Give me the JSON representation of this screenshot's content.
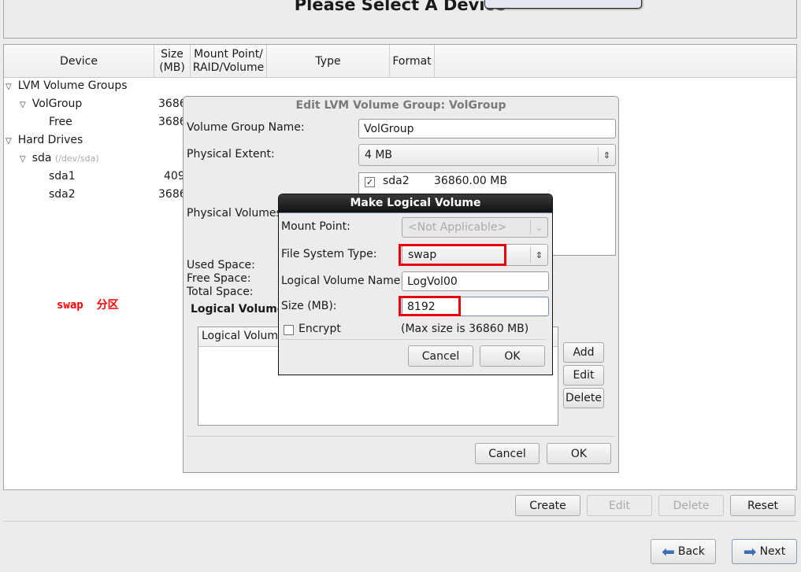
{
  "header": {
    "title": "Please Select A Device"
  },
  "table": {
    "columns": [
      "Device",
      "Size\n(MB)",
      "Mount Point/\nRAID/Volume",
      "Type",
      "Format"
    ],
    "col_device": "Device",
    "col_size_1": "Size",
    "col_size_2": "(MB)",
    "col_mount_1": "Mount Point/",
    "col_mount_2": "RAID/Volume",
    "col_type": "Type",
    "col_format": "Format",
    "rows": [
      {
        "label": "LVM Volume Groups",
        "size": ""
      },
      {
        "label": "VolGroup",
        "size": "3686"
      },
      {
        "label": "Free",
        "size": "3686"
      },
      {
        "label": "Hard Drives",
        "size": ""
      },
      {
        "label": "sda",
        "sub": "(/dev/sda)",
        "size": ""
      },
      {
        "label": "sda1",
        "size": "409"
      },
      {
        "label": "sda2",
        "size": "3686"
      }
    ]
  },
  "annotation": {
    "text": "swap  分区",
    "color": "#ff0000"
  },
  "lvm_dialog": {
    "title": "Edit LVM Volume Group: VolGroup",
    "vg_name_label": "Volume Group Name:",
    "vg_name_value": "VolGroup",
    "extent_label": "Physical Extent:",
    "extent_value": "4 MB",
    "pv_label": "Physical Volumes",
    "pv_items": [
      {
        "checked": true,
        "name": "sda2",
        "size": "36860.00 MB"
      }
    ],
    "used_label": "Used Space:",
    "free_label": "Free Space:",
    "total_label": "Total Space:",
    "lv_section": "Logical Volume",
    "lv_col": "Logical Volume",
    "add": "Add",
    "edit": "Edit",
    "delete": "Delete",
    "cancel": "Cancel",
    "ok": "OK"
  },
  "make_lv": {
    "title": "Make Logical Volume",
    "mount_label": "Mount Point:",
    "mount_value": "<Not Applicable>",
    "fs_label": "File System Type:",
    "fs_value": "swap",
    "name_label": "Logical Volume Name:",
    "name_value": "LogVol00",
    "size_label": "Size (MB):",
    "size_value": "8192",
    "encrypt_label": "Encrypt",
    "encrypt_checked": false,
    "max_size": "(Max size is 36860 MB)",
    "cancel": "Cancel",
    "ok": "OK"
  },
  "actions": {
    "create": "Create",
    "edit": "Edit",
    "delete": "Delete",
    "reset": "Reset"
  },
  "nav": {
    "back": "Back",
    "next": "Next"
  },
  "colors": {
    "highlight": "#e8000b",
    "dialog_header": "#1e1e1e",
    "nav_arrow": "#3a6fb5"
  }
}
